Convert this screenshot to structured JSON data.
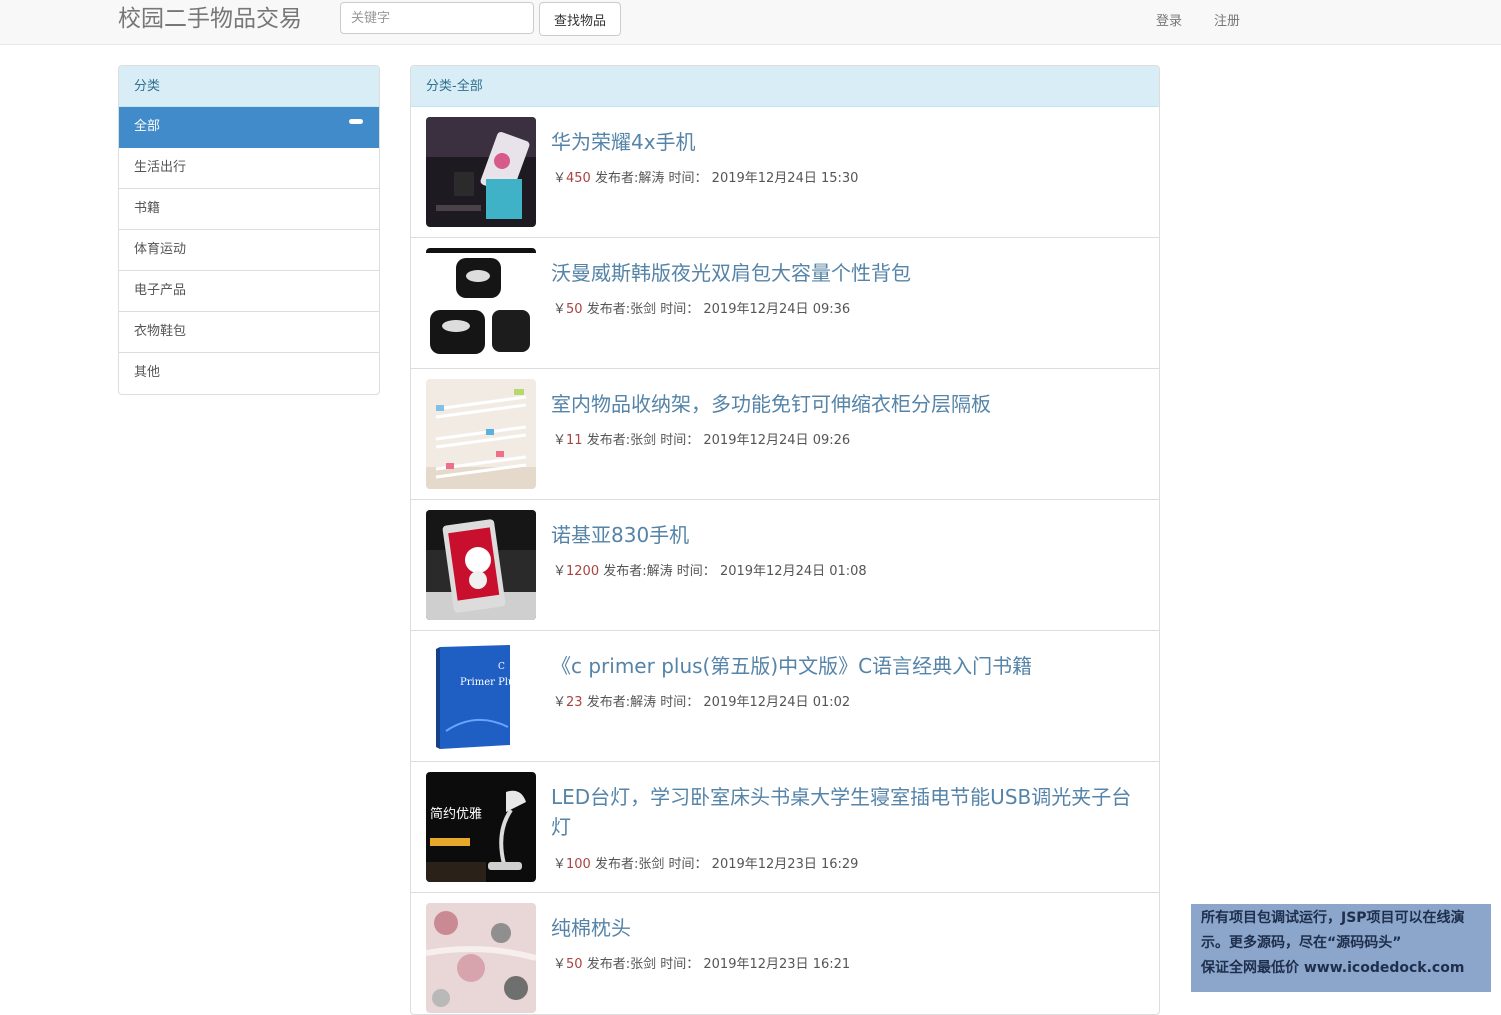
{
  "header": {
    "brand": "校园二手物品交易",
    "search_placeholder": "关键字",
    "search_button": "查找物品",
    "login": "登录",
    "register": "注册"
  },
  "sidebar": {
    "heading": "分类",
    "items": [
      {
        "label": "全部",
        "active": true
      },
      {
        "label": "生活出行"
      },
      {
        "label": "书籍"
      },
      {
        "label": "体育运动"
      },
      {
        "label": "电子产品"
      },
      {
        "label": "衣物鞋包"
      },
      {
        "label": "其他"
      }
    ]
  },
  "main": {
    "heading": "分类-全部",
    "items": [
      {
        "title": "华为荣耀4x手机",
        "currency": "￥",
        "price": "450",
        "publisher": "发布者:解涛",
        "time_label": "时间：",
        "time": "2019年12月24日 15:30",
        "icon": "phone-photo"
      },
      {
        "title": "沃曼威斯韩版夜光双肩包大容量个性背包",
        "currency": "￥",
        "price": "50",
        "publisher": "发布者:张剑",
        "time_label": "时间：",
        "time": "2019年12月24日 09:36",
        "icon": "backpack-photo"
      },
      {
        "title": "室内物品收纳架，多功能免钉可伸缩衣柜分层隔板",
        "currency": "￥",
        "price": "11",
        "publisher": "发布者:张剑",
        "time_label": "时间：",
        "time": "2019年12月24日 09:26",
        "icon": "shelf-photo"
      },
      {
        "title": "诺基亚830手机",
        "currency": "￥",
        "price": "1200",
        "publisher": "发布者:解涛",
        "time_label": "时间：",
        "time": "2019年12月24日 01:08",
        "icon": "nokia-phone-photo"
      },
      {
        "title": "《c primer plus(第五版)中文版》C语言经典入门书籍",
        "currency": "￥",
        "price": "23",
        "publisher": "发布者:解涛",
        "time_label": "时间：",
        "time": "2019年12月24日 01:02",
        "icon": "book-photo",
        "cover_text": "Primer Plus"
      },
      {
        "title": "LED台灯，学习卧室床头书桌大学生寝室插电节能USB调光夹子台灯",
        "currency": "￥",
        "price": "100",
        "publisher": "发布者:张剑",
        "time_label": "时间：",
        "time": "2019年12月23日 16:29",
        "icon": "lamp-photo",
        "cover_text": "简约优雅"
      },
      {
        "title": "纯棉枕头",
        "currency": "￥",
        "price": "50",
        "publisher": "发布者:张剑",
        "time_label": "时间：",
        "time": "2019年12月23日 16:21",
        "icon": "pillow-photo"
      }
    ]
  },
  "promo": {
    "line1": "所有项目包调试运行，JSP项目可以在线演",
    "line2": "示。更多源码，尽在“源码码头”",
    "line3": "保证全网最低价 www.icodedock.com"
  }
}
